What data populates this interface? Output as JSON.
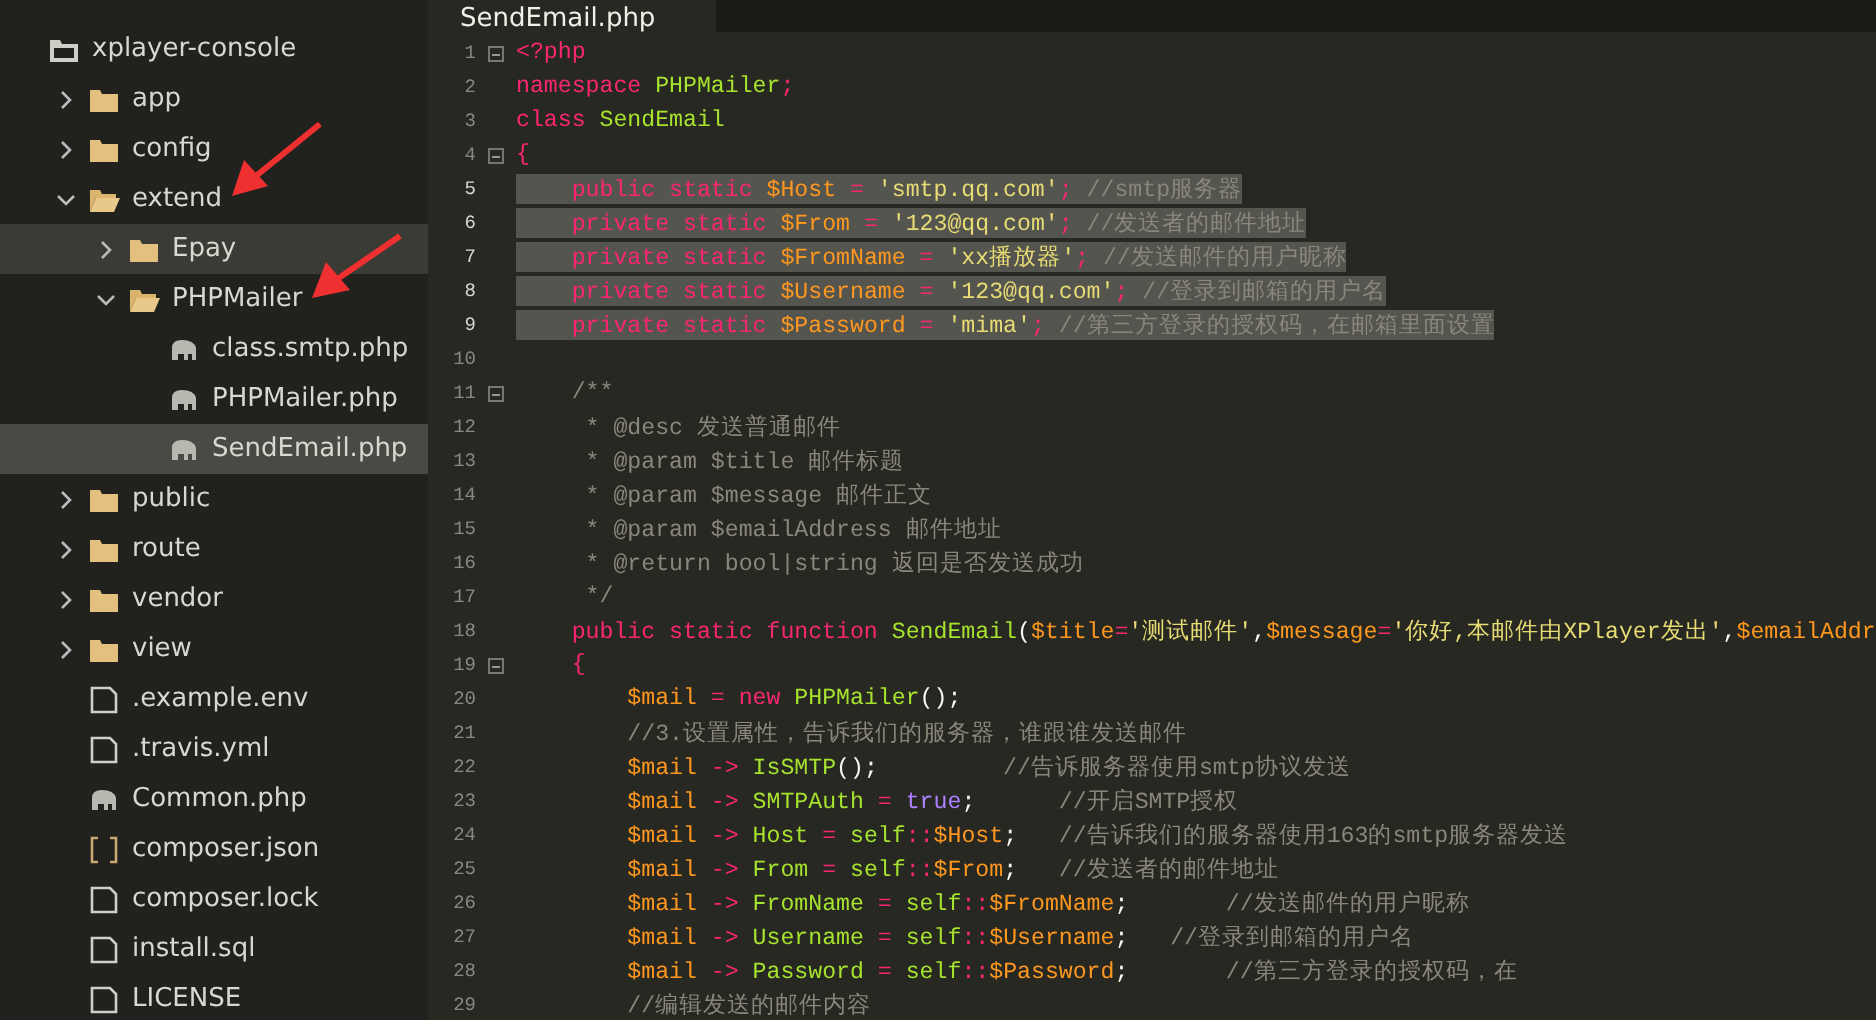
{
  "sidebar": {
    "tree": [
      {
        "label": "xplayer-console",
        "kind": "root",
        "selected": false,
        "hovered": false,
        "children": [
          {
            "label": "app",
            "kind": "folder",
            "expanded": false,
            "selected": false,
            "hovered": false
          },
          {
            "label": "config",
            "kind": "folder",
            "expanded": false,
            "selected": false,
            "hovered": false
          },
          {
            "label": "extend",
            "kind": "folder",
            "expanded": true,
            "selected": false,
            "hovered": false,
            "children": [
              {
                "label": "Epay",
                "kind": "folder",
                "expanded": false,
                "selected": false,
                "hovered": true
              },
              {
                "label": "PHPMailer",
                "kind": "folder",
                "expanded": true,
                "selected": false,
                "hovered": false,
                "children": [
                  {
                    "label": "class.smtp.php",
                    "kind": "php",
                    "selected": false,
                    "hovered": false
                  },
                  {
                    "label": "PHPMailer.php",
                    "kind": "php",
                    "selected": false,
                    "hovered": false
                  },
                  {
                    "label": "SendEmail.php",
                    "kind": "php",
                    "selected": true,
                    "hovered": false
                  }
                ]
              }
            ]
          },
          {
            "label": "public",
            "kind": "folder",
            "expanded": false,
            "selected": false,
            "hovered": false
          },
          {
            "label": "route",
            "kind": "folder",
            "expanded": false,
            "selected": false,
            "hovered": false
          },
          {
            "label": "vendor",
            "kind": "folder",
            "expanded": false,
            "selected": false,
            "hovered": false
          },
          {
            "label": "view",
            "kind": "folder",
            "expanded": false,
            "selected": false,
            "hovered": false
          },
          {
            "label": ".example.env",
            "kind": "file",
            "selected": false,
            "hovered": false
          },
          {
            "label": ".travis.yml",
            "kind": "file",
            "selected": false,
            "hovered": false
          },
          {
            "label": "Common.php",
            "kind": "php",
            "selected": false,
            "hovered": false
          },
          {
            "label": "composer.json",
            "kind": "json",
            "selected": false,
            "hovered": false
          },
          {
            "label": "composer.lock",
            "kind": "file",
            "selected": false,
            "hovered": false
          },
          {
            "label": "install.sql",
            "kind": "file",
            "selected": false,
            "hovered": false
          },
          {
            "label": "LICENSE",
            "kind": "file",
            "selected": false,
            "hovered": false
          }
        ]
      }
    ]
  },
  "tabs": [
    {
      "label": "SendEmail.php",
      "selected": true
    }
  ],
  "editor": {
    "lines": [
      {
        "number": "1",
        "foldable": true,
        "selected": false,
        "tokens": [
          {
            "kind": "keyword",
            "text": "<?php"
          }
        ]
      },
      {
        "number": "2",
        "foldable": false,
        "selected": false,
        "tokens": [
          {
            "kind": "keyword",
            "text": "namespace "
          },
          {
            "kind": "name",
            "text": "PHPMailer"
          },
          {
            "kind": "operator",
            "text": ";"
          }
        ]
      },
      {
        "number": "3",
        "foldable": false,
        "selected": false,
        "tokens": [
          {
            "kind": "keyword",
            "text": "class "
          },
          {
            "kind": "name",
            "text": "SendEmail"
          }
        ]
      },
      {
        "number": "4",
        "foldable": true,
        "selected": false,
        "tokens": [
          {
            "kind": "operator",
            "text": "{"
          }
        ]
      },
      {
        "number": "5",
        "foldable": false,
        "selected": true,
        "tokens": [
          {
            "kind": "keyword",
            "text": "    public static "
          },
          {
            "kind": "variable",
            "text": "$Host"
          },
          {
            "kind": "operator",
            "text": " = "
          },
          {
            "kind": "string",
            "text": "'smtp.qq.com'"
          },
          {
            "kind": "operator",
            "text": ";"
          },
          {
            "kind": "comment",
            "text": " //smtp服务器"
          }
        ]
      },
      {
        "number": "6",
        "foldable": false,
        "selected": true,
        "tokens": [
          {
            "kind": "keyword",
            "text": "    private static "
          },
          {
            "kind": "variable",
            "text": "$From"
          },
          {
            "kind": "operator",
            "text": " = "
          },
          {
            "kind": "string",
            "text": "'123@qq.com'"
          },
          {
            "kind": "operator",
            "text": ";"
          },
          {
            "kind": "comment",
            "text": " //发送者的邮件地址"
          }
        ]
      },
      {
        "number": "7",
        "foldable": false,
        "selected": true,
        "tokens": [
          {
            "kind": "keyword",
            "text": "    private static "
          },
          {
            "kind": "variable",
            "text": "$FromName"
          },
          {
            "kind": "operator",
            "text": " = "
          },
          {
            "kind": "string",
            "text": "'xx播放器'"
          },
          {
            "kind": "operator",
            "text": ";"
          },
          {
            "kind": "comment",
            "text": " //发送邮件的用户昵称"
          }
        ]
      },
      {
        "number": "8",
        "foldable": false,
        "selected": true,
        "tokens": [
          {
            "kind": "keyword",
            "text": "    private static "
          },
          {
            "kind": "variable",
            "text": "$Username"
          },
          {
            "kind": "operator",
            "text": " = "
          },
          {
            "kind": "string",
            "text": "'123@qq.com'"
          },
          {
            "kind": "operator",
            "text": ";"
          },
          {
            "kind": "comment",
            "text": " //登录到邮箱的用户名"
          }
        ]
      },
      {
        "number": "9",
        "foldable": false,
        "selected": true,
        "tokens": [
          {
            "kind": "keyword",
            "text": "    private static "
          },
          {
            "kind": "variable",
            "text": "$Password"
          },
          {
            "kind": "operator",
            "text": " = "
          },
          {
            "kind": "string",
            "text": "'mima'"
          },
          {
            "kind": "operator",
            "text": ";"
          },
          {
            "kind": "comment",
            "text": " //第三方登录的授权码，在邮箱里面设置"
          }
        ]
      },
      {
        "number": "10",
        "foldable": false,
        "selected": false
      },
      {
        "number": "11",
        "foldable": true,
        "selected": false,
        "tokens": [
          {
            "kind": "comment",
            "text": "    /**"
          }
        ]
      },
      {
        "number": "12",
        "foldable": false,
        "selected": false,
        "tokens": [
          {
            "kind": "comment",
            "text": "     * @desc 发送普通邮件"
          }
        ]
      },
      {
        "number": "13",
        "foldable": false,
        "selected": false,
        "tokens": [
          {
            "kind": "comment",
            "text": "     * @param $title 邮件标题"
          }
        ]
      },
      {
        "number": "14",
        "foldable": false,
        "selected": false,
        "tokens": [
          {
            "kind": "comment",
            "text": "     * @param $message 邮件正文"
          }
        ]
      },
      {
        "number": "15",
        "foldable": false,
        "selected": false,
        "tokens": [
          {
            "kind": "comment",
            "text": "     * @param $emailAddress 邮件地址"
          }
        ]
      },
      {
        "number": "16",
        "foldable": false,
        "selected": false,
        "tokens": [
          {
            "kind": "comment",
            "text": "     * @return bool|string 返回是否发送成功"
          }
        ]
      },
      {
        "number": "17",
        "foldable": false,
        "selected": false,
        "tokens": [
          {
            "kind": "comment",
            "text": "     */"
          }
        ]
      },
      {
        "number": "18",
        "foldable": false,
        "selected": false,
        "tokens": [
          {
            "kind": "keyword",
            "text": "    public static function "
          },
          {
            "kind": "name",
            "text": "SendEmail"
          },
          {
            "kind": "plain",
            "text": "("
          },
          {
            "kind": "variable",
            "text": "$title"
          },
          {
            "kind": "operator",
            "text": "="
          },
          {
            "kind": "string",
            "text": "'测试邮件'"
          },
          {
            "kind": "plain",
            "text": ","
          },
          {
            "kind": "variable",
            "text": "$message"
          },
          {
            "kind": "operator",
            "text": "="
          },
          {
            "kind": "string",
            "text": "'你好,本邮件由XPlayer发出'"
          },
          {
            "kind": "plain",
            "text": ","
          },
          {
            "kind": "variable",
            "text": "$emailAddr"
          }
        ]
      },
      {
        "number": "19",
        "foldable": true,
        "selected": false,
        "tokens": [
          {
            "kind": "operator",
            "text": "    {"
          }
        ]
      },
      {
        "number": "20",
        "foldable": false,
        "selected": false,
        "tokens": [
          {
            "kind": "variable",
            "text": "        $mail"
          },
          {
            "kind": "operator",
            "text": " = "
          },
          {
            "kind": "keyword",
            "text": "new "
          },
          {
            "kind": "name",
            "text": "PHPMailer"
          },
          {
            "kind": "plain",
            "text": "();"
          }
        ]
      },
      {
        "number": "21",
        "foldable": false,
        "selected": false,
        "tokens": [
          {
            "kind": "comment",
            "text": "        //3.设置属性，告诉我们的服务器，谁跟谁发送邮件"
          }
        ]
      },
      {
        "number": "22",
        "foldable": false,
        "selected": false,
        "tokens": [
          {
            "kind": "variable",
            "text": "        $mail"
          },
          {
            "kind": "operator",
            "text": " -> "
          },
          {
            "kind": "name",
            "text": "IsSMTP"
          },
          {
            "kind": "plain",
            "text": "();"
          },
          {
            "kind": "comment",
            "text": "         //告诉服务器使用smtp协议发送"
          }
        ]
      },
      {
        "number": "23",
        "foldable": false,
        "selected": false,
        "tokens": [
          {
            "kind": "variable",
            "text": "        $mail"
          },
          {
            "kind": "operator",
            "text": " -> "
          },
          {
            "kind": "name",
            "text": "SMTPAuth"
          },
          {
            "kind": "operator",
            "text": " = "
          },
          {
            "kind": "constant",
            "text": "true"
          },
          {
            "kind": "plain",
            "text": ";"
          },
          {
            "kind": "comment",
            "text": "      //开启SMTP授权"
          }
        ]
      },
      {
        "number": "24",
        "foldable": false,
        "selected": false,
        "tokens": [
          {
            "kind": "variable",
            "text": "        $mail"
          },
          {
            "kind": "operator",
            "text": " -> "
          },
          {
            "kind": "name",
            "text": "Host"
          },
          {
            "kind": "operator",
            "text": " = "
          },
          {
            "kind": "name",
            "text": "self"
          },
          {
            "kind": "operator",
            "text": "::"
          },
          {
            "kind": "variable",
            "text": "$Host"
          },
          {
            "kind": "plain",
            "text": ";"
          },
          {
            "kind": "comment",
            "text": "   //告诉我们的服务器使用163的smtp服务器发送"
          }
        ]
      },
      {
        "number": "25",
        "foldable": false,
        "selected": false,
        "tokens": [
          {
            "kind": "variable",
            "text": "        $mail"
          },
          {
            "kind": "operator",
            "text": " -> "
          },
          {
            "kind": "name",
            "text": "From"
          },
          {
            "kind": "operator",
            "text": " = "
          },
          {
            "kind": "name",
            "text": "self"
          },
          {
            "kind": "operator",
            "text": "::"
          },
          {
            "kind": "variable",
            "text": "$From"
          },
          {
            "kind": "plain",
            "text": ";"
          },
          {
            "kind": "comment",
            "text": "   //发送者的邮件地址"
          }
        ]
      },
      {
        "number": "26",
        "foldable": false,
        "selected": false,
        "tokens": [
          {
            "kind": "variable",
            "text": "        $mail"
          },
          {
            "kind": "operator",
            "text": " -> "
          },
          {
            "kind": "name",
            "text": "FromName"
          },
          {
            "kind": "operator",
            "text": " = "
          },
          {
            "kind": "name",
            "text": "self"
          },
          {
            "kind": "operator",
            "text": "::"
          },
          {
            "kind": "variable",
            "text": "$FromName"
          },
          {
            "kind": "plain",
            "text": ";"
          },
          {
            "kind": "comment",
            "text": "       //发送邮件的用户昵称"
          }
        ]
      },
      {
        "number": "27",
        "foldable": false,
        "selected": false,
        "tokens": [
          {
            "kind": "variable",
            "text": "        $mail"
          },
          {
            "kind": "operator",
            "text": " -> "
          },
          {
            "kind": "name",
            "text": "Username"
          },
          {
            "kind": "operator",
            "text": " = "
          },
          {
            "kind": "name",
            "text": "self"
          },
          {
            "kind": "operator",
            "text": "::"
          },
          {
            "kind": "variable",
            "text": "$Username"
          },
          {
            "kind": "plain",
            "text": ";"
          },
          {
            "kind": "comment",
            "text": "   //登录到邮箱的用户名"
          }
        ]
      },
      {
        "number": "28",
        "foldable": false,
        "selected": false,
        "tokens": [
          {
            "kind": "variable",
            "text": "        $mail"
          },
          {
            "kind": "operator",
            "text": " -> "
          },
          {
            "kind": "name",
            "text": "Password"
          },
          {
            "kind": "operator",
            "text": " = "
          },
          {
            "kind": "name",
            "text": "self"
          },
          {
            "kind": "operator",
            "text": "::"
          },
          {
            "kind": "variable",
            "text": "$Password"
          },
          {
            "kind": "plain",
            "text": ";"
          },
          {
            "kind": "comment",
            "text": "       //第三方登录的授权码，在"
          }
        ]
      },
      {
        "number": "29",
        "foldable": false,
        "selected": false,
        "tokens": [
          {
            "kind": "comment",
            "text": "        //编辑发送的邮件内容"
          }
        ]
      }
    ]
  }
}
